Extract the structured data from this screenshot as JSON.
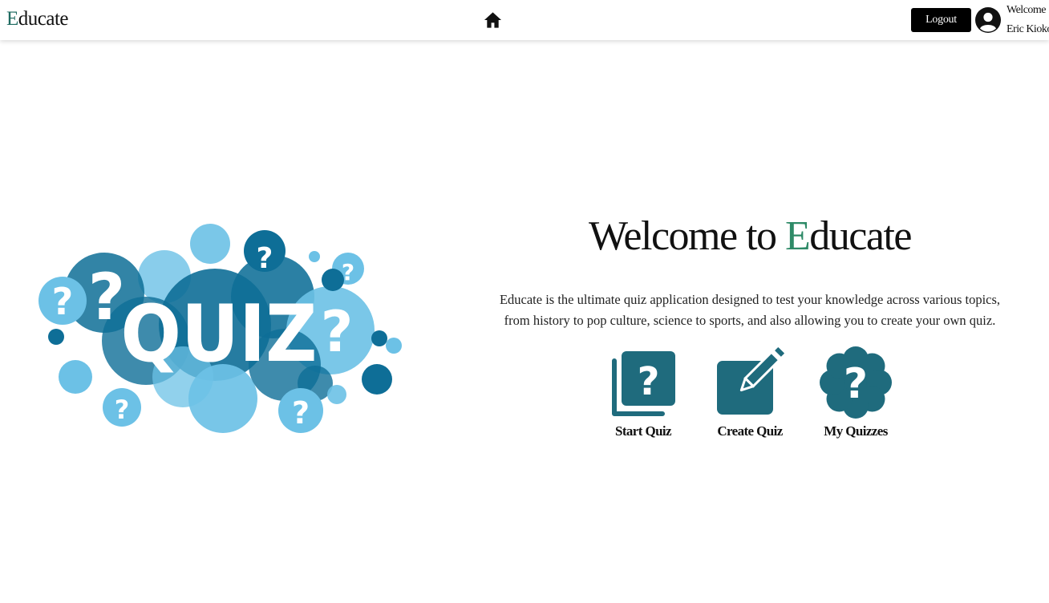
{
  "header": {
    "logo_initial": "E",
    "logo_rest": "ducate",
    "home_icon": "home-icon",
    "logout_label": "Logout",
    "avatar_icon": "user-circle-icon",
    "welcome_line1": "Welcome",
    "welcome_line2": "Eric Kioko"
  },
  "hero": {
    "art_word": "QUIZ",
    "art_glyph": "?",
    "title_prefix": "Welcome to ",
    "title_highlight": "E",
    "title_suffix": "ducate",
    "description_line1": "Educate is the ultimate quiz application designed to test your knowledge across various topics,",
    "description_line2": "from history to pop culture, science to sports, and also allowing you to create your own quiz."
  },
  "actions": [
    {
      "label": "Start Quiz",
      "icon": "stacked-question-cards-icon"
    },
    {
      "label": "Create Quiz",
      "icon": "pencil-square-icon"
    },
    {
      "label": "My Quizzes",
      "icon": "question-badge-icon"
    }
  ],
  "colors": {
    "brand_teal": "#1f6b7d",
    "logo_green": "#1f6b61",
    "headline_green": "#2e8a67",
    "bubble_dark": "#0e6e97",
    "bubble_light": "#6cc1e6",
    "button_black": "#000000"
  }
}
